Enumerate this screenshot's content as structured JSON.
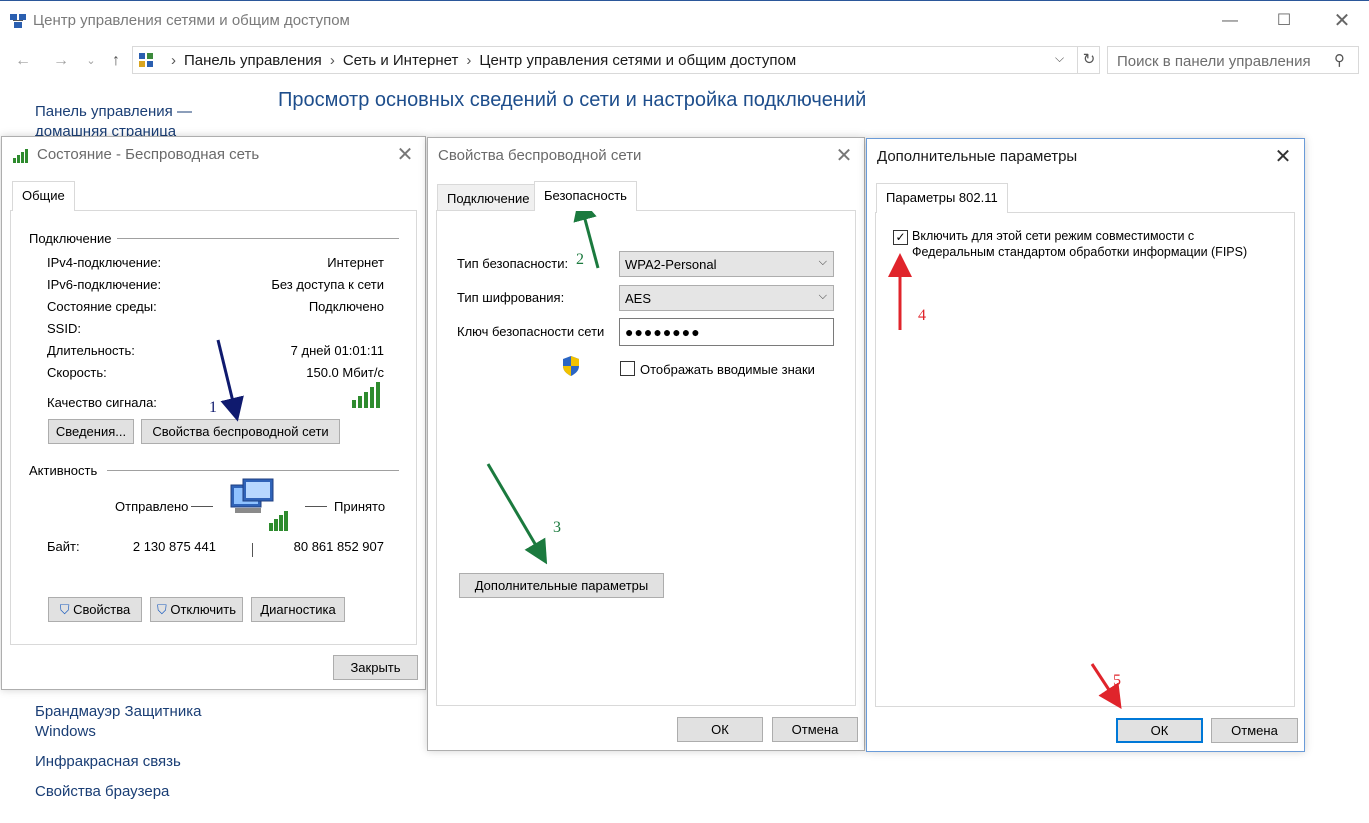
{
  "window": {
    "title": "Центр управления сетями и общим доступом",
    "min_icon": "minimize-icon",
    "max_icon": "maximize-icon",
    "close_icon": "close-icon"
  },
  "nav": {
    "breadcrumbs": [
      "Панель управления",
      "Сеть и Интернет",
      "Центр управления сетями и общим доступом"
    ],
    "search_placeholder": "Поиск в панели управления"
  },
  "left_links": {
    "home": "Панель управления — домашняя страница",
    "firewall": "Брандмауэр Защитника Windows",
    "infrared": "Инфракрасная связь",
    "browser": "Свойства браузера"
  },
  "main_heading": "Просмотр основных сведений о сети и настройка подключений",
  "status_dialog": {
    "title": "Состояние - Беспроводная сеть",
    "tab": "Общие",
    "connection_group": "Подключение",
    "rows": [
      {
        "label": "IPv4-подключение:",
        "value": "Интернет"
      },
      {
        "label": "IPv6-подключение:",
        "value": "Без доступа к сети"
      },
      {
        "label": "Состояние среды:",
        "value": "Подключено"
      },
      {
        "label": "SSID:",
        "value": ""
      },
      {
        "label": "Длительность:",
        "value": "7 дней 01:01:11"
      },
      {
        "label": "Скорость:",
        "value": "150.0 Мбит/с"
      }
    ],
    "signal_label": "Качество сигнала:",
    "details_button": "Сведения...",
    "wireless_props_button": "Свойства беспроводной сети",
    "activity_group": "Активность",
    "sent_label": "Отправлено",
    "received_label": "Принято",
    "bytes_label": "Байт:",
    "bytes_sent": "2 130 875 441",
    "bytes_received": "80 861 852 907",
    "properties_button": "Свойства",
    "disable_button": "Отключить",
    "diagnose_button": "Диагностика",
    "close_button": "Закрыть"
  },
  "wireless_dialog": {
    "title": "Свойства беспроводной сети",
    "tab_connection": "Подключение",
    "tab_security": "Безопасность",
    "security_type_label": "Тип безопасности:",
    "security_type_value": "WPA2-Personal",
    "encryption_label": "Тип шифрования:",
    "encryption_value": "AES",
    "key_label": "Ключ безопасности сети",
    "key_value": "●●●●●●●●",
    "show_chars_label": "Отображать вводимые знаки",
    "advanced_button": "Дополнительные параметры",
    "ok_button": "ОК",
    "cancel_button": "Отмена"
  },
  "advanced_dialog": {
    "title": "Дополнительные параметры",
    "tab": "Параметры 802.11",
    "fips_line1": "Включить для этой сети режим совместимости с",
    "fips_line2": "Федеральным стандартом обработки информации (FIPS)",
    "fips_checked": true,
    "ok_button": "ОК",
    "cancel_button": "Отмена"
  },
  "annotations": {
    "step1": "1",
    "step2": "2",
    "step3": "3",
    "step4": "4",
    "step5": "5",
    "colors": {
      "step1": "#0f1a6e",
      "step2": "#1b7a3e",
      "step3": "#1b7a3e",
      "step4": "#e0242b",
      "step5": "#e0242b"
    }
  }
}
